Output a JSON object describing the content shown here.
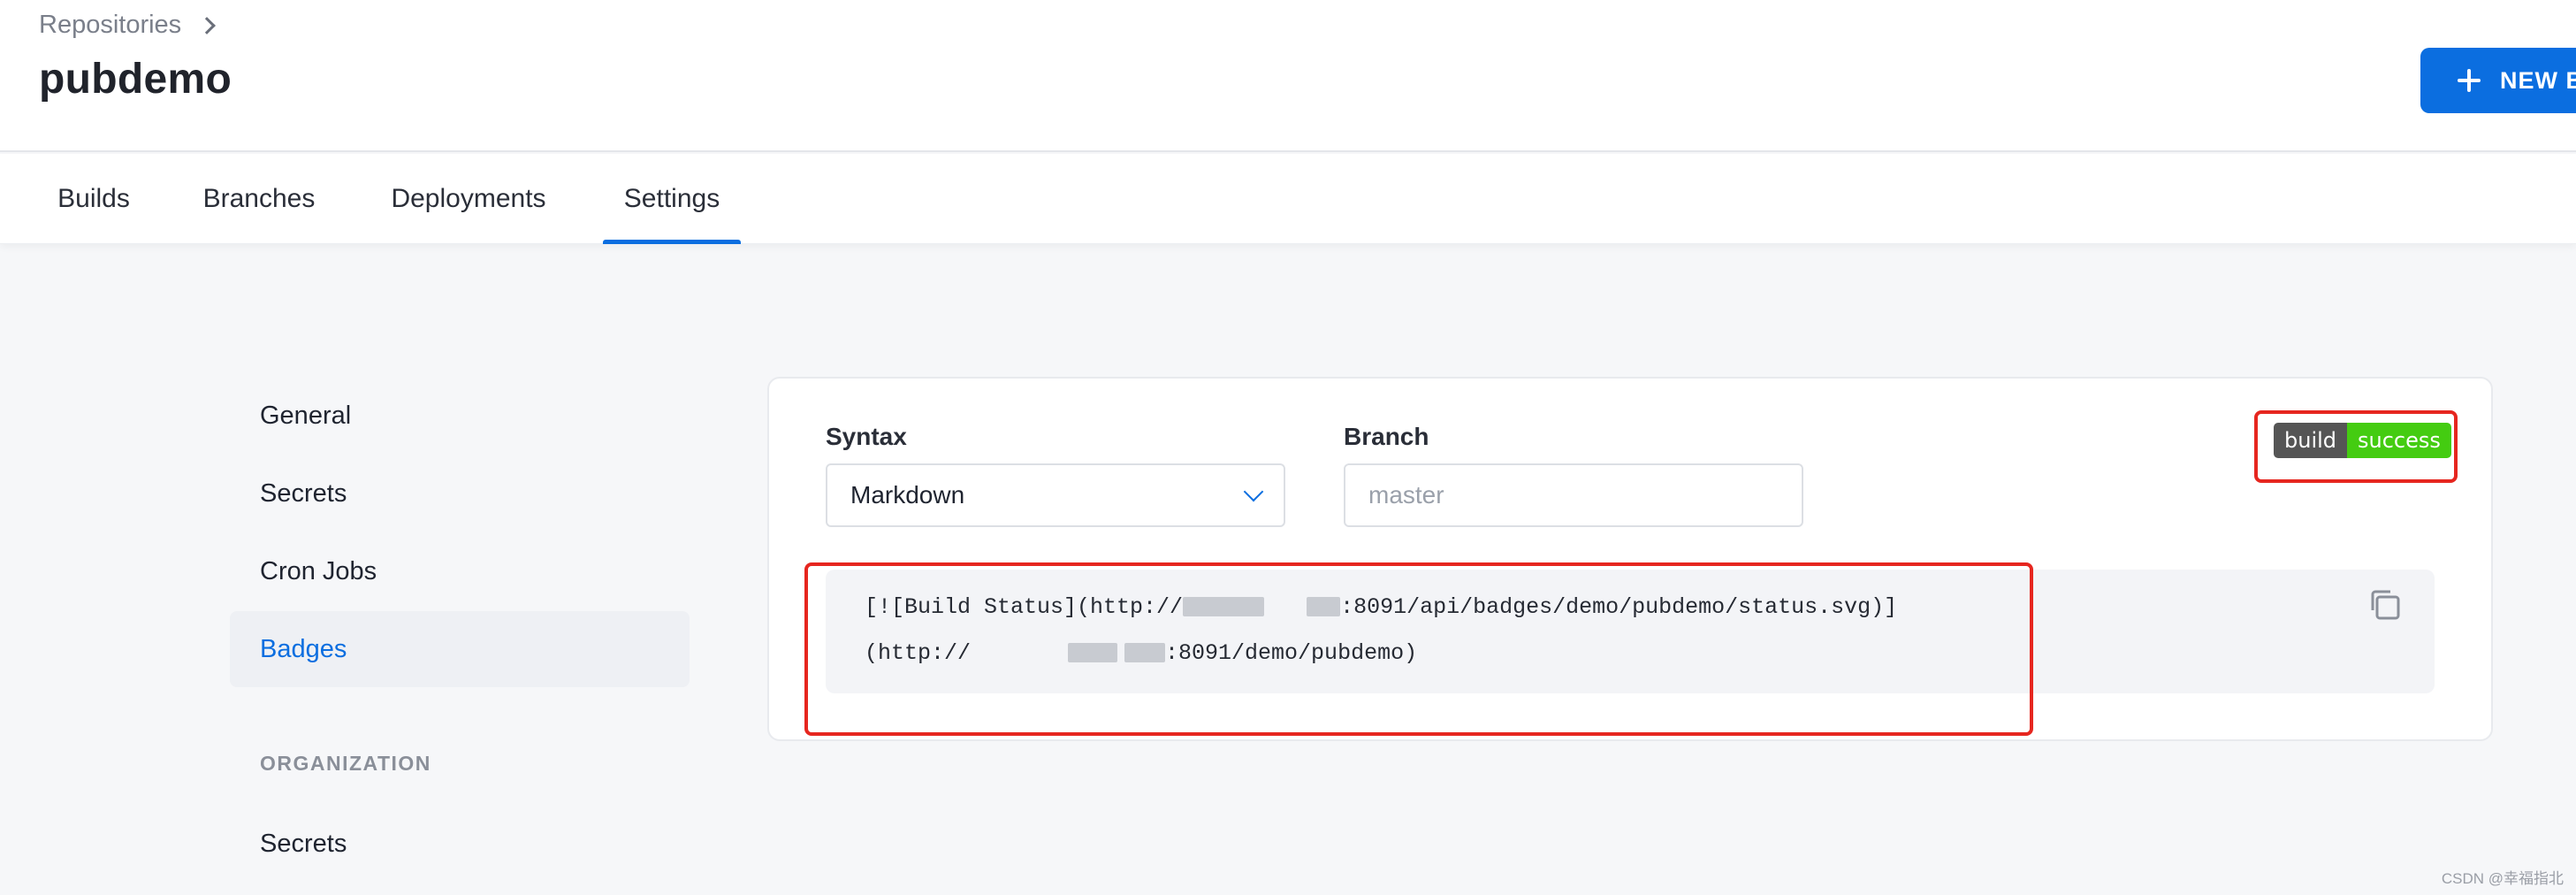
{
  "header": {
    "breadcrumb": "Repositories",
    "title": "pubdemo",
    "new_button_label": "NEW B"
  },
  "tabs": [
    {
      "label": "Builds"
    },
    {
      "label": "Branches"
    },
    {
      "label": "Deployments"
    },
    {
      "label": "Settings",
      "active": true
    }
  ],
  "sidebar": {
    "items": [
      {
        "label": "General"
      },
      {
        "label": "Secrets"
      },
      {
        "label": "Cron Jobs"
      },
      {
        "label": "Badges",
        "active": true
      }
    ],
    "organization_heading": "ORGANIZATION",
    "organization_items": [
      {
        "label": "Secrets"
      }
    ]
  },
  "badges": {
    "syntax_label": "Syntax",
    "syntax_value": "Markdown",
    "branch_label": "Branch",
    "branch_placeholder": "master",
    "badge_left": "build",
    "badge_right": "success",
    "code_line1_start": "[![Build Status](http://",
    "code_line1_end": ":8091/api/badges/demo/pubdemo/status.svg)]",
    "code_line2_start": "(http://",
    "code_line2_end": ":8091/demo/pubdemo)"
  },
  "colors": {
    "accent": "#0b6ee0",
    "badge_left": "#555555",
    "badge_right": "#44cc11",
    "annotation": "#e6261f"
  },
  "watermark": "CSDN @幸福指北"
}
